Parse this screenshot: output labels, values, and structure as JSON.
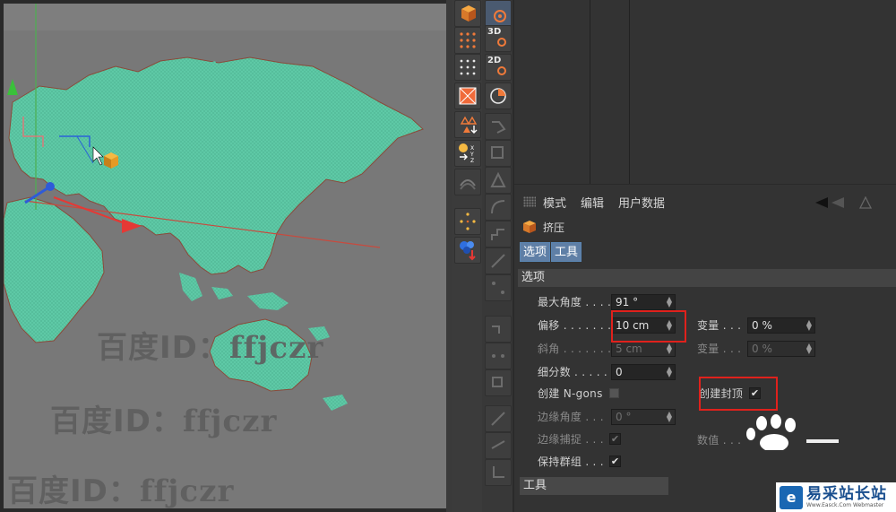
{
  "watermarks": [
    {
      "cjk": "百度ID：",
      "id": "ffjczr"
    },
    {
      "cjk": "百度ID：",
      "id": "ffjczr"
    },
    {
      "cjk": "百度ID：",
      "id": "ffjczr"
    }
  ],
  "palette": {
    "btn_3d": "3D",
    "btn_2d": "2D"
  },
  "attr": {
    "menu": [
      "模式",
      "编辑",
      "用户数据"
    ],
    "object_name": "挤压",
    "tabs": [
      "选项",
      "工具"
    ],
    "section": "选项",
    "rows": {
      "max_angle": {
        "label": "最大角度 . . . .",
        "value": "91 °"
      },
      "offset": {
        "label": "偏移 . . . . . . . .",
        "value": "10 cm"
      },
      "variance1": {
        "label": "变量 . . .",
        "value": "0 %"
      },
      "bevel": {
        "label": "斜角 . . . . . . . .",
        "value": "5 cm"
      },
      "variance2": {
        "label": "变量 . . .",
        "value": "0 %"
      },
      "subdivision": {
        "label": "细分数 . . . . . .",
        "value": "0"
      },
      "create_ngons": {
        "label": "创建 N-gons"
      },
      "create_caps": {
        "label": "创建封顶",
        "checked": "✔"
      },
      "edge_angle": {
        "label": "边缘角度 . . .",
        "value": "0 °"
      },
      "edge_snap": {
        "label": "边缘捕捉 . . .",
        "checked": "✔"
      },
      "data": {
        "label": "数值 . . ."
      },
      "keep_groups": {
        "label": "保持群组 . . .",
        "checked": "✔"
      }
    },
    "tool_section": "工具"
  },
  "brand": {
    "logo": "e",
    "name": "易采站长站",
    "url": "Www.Easck.Com Webmaster"
  },
  "colors": {
    "map": "#5ec9a6",
    "highlight": "#e0211c",
    "tab_active": "#5f7fa6"
  }
}
